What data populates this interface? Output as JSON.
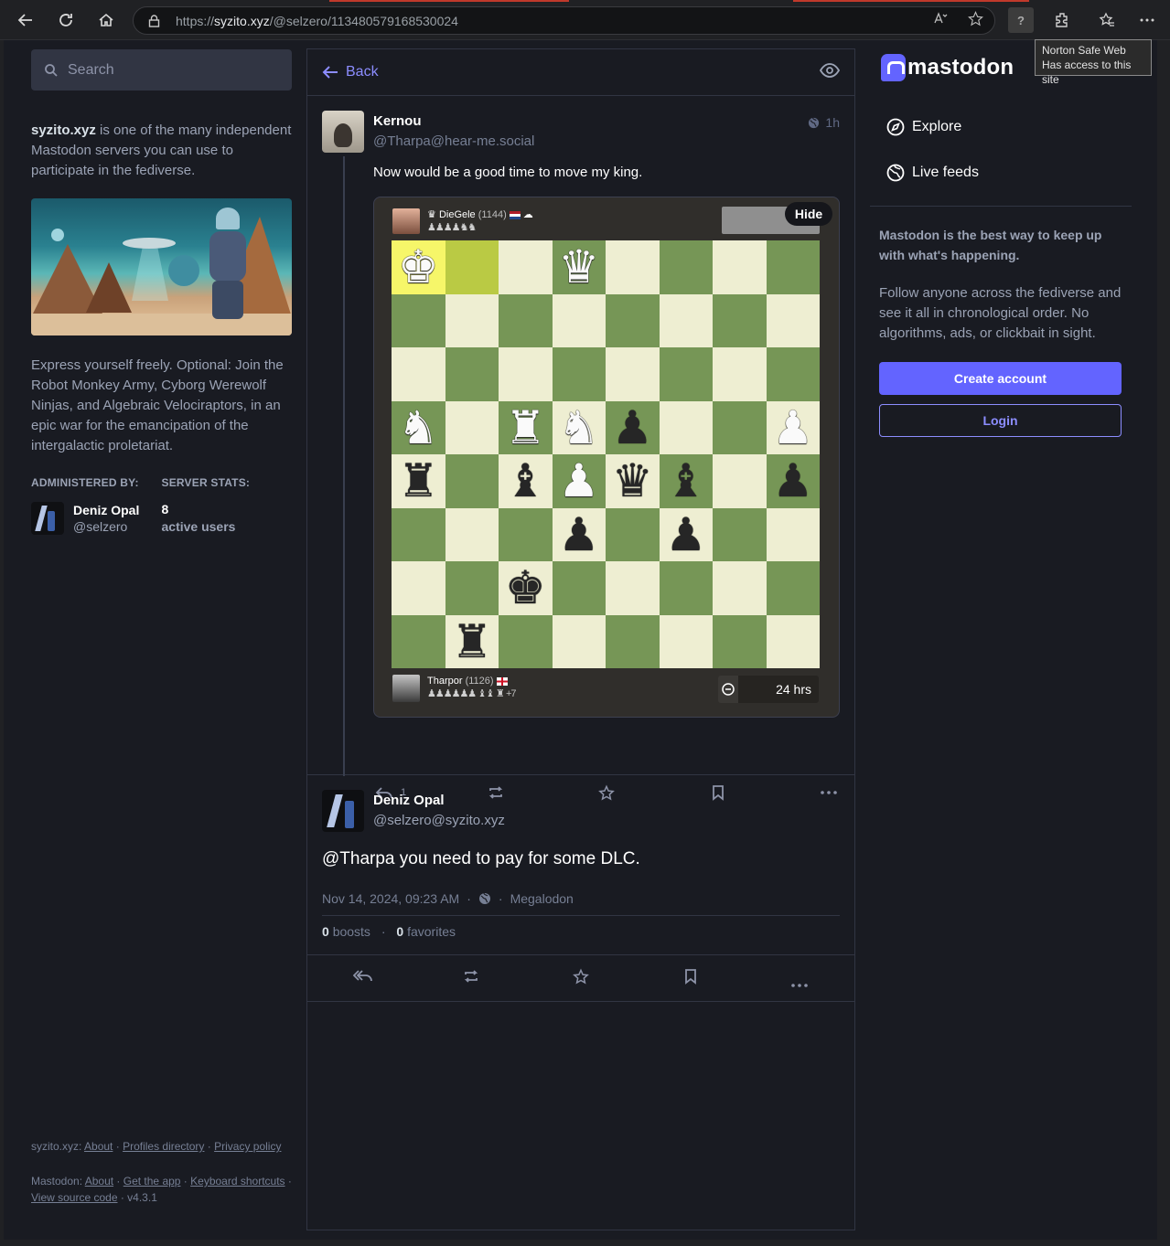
{
  "browser": {
    "url_scheme": "https://",
    "url_host": "syzito.xyz",
    "url_path": "/@selzero/113480579168530024",
    "tooltip_line1": "Norton Safe Web",
    "tooltip_line2": "Has access to this site",
    "norton_badge": "?"
  },
  "left": {
    "search_placeholder": "Search",
    "about_server": "syzito.xyz",
    "about_rest": " is one of the many independent Mastodon servers you can use to participate in the fediverse.",
    "description": "Express yourself freely. Optional: Join the Robot Monkey Army, Cyborg Werewolf Ninjas, and Algebraic Velociraptors, in an epic war for the emancipation of the intergalactic proletariat.",
    "admin_heading": "Administered by:",
    "admin_name": "Deniz Opal",
    "admin_handle": "@selzero",
    "stats_heading": "Server stats:",
    "stats_count": "8",
    "stats_label": "active users",
    "footer1_server": "syzito.xyz",
    "footer1_links": [
      "About",
      "Profiles directory",
      "Privacy policy"
    ],
    "footer2_label": "Mastodon",
    "footer2_links": [
      "About",
      "Get the app",
      "Keyboard shortcuts",
      "View source code"
    ],
    "version": "v4.3.1"
  },
  "center": {
    "back_label": "Back",
    "status1": {
      "display_name": "Kernou",
      "handle": "@Tharpa@hear-me.social",
      "time": "1h",
      "text": "Now would be a good time to move my king.",
      "reply_count": "1",
      "media": {
        "hide_label": "Hide",
        "top_player_name": "DieGele",
        "top_player_rating": "(1144)",
        "top_player_caps": "♟♟♟♟♞♞",
        "bottom_player_name": "Tharpor",
        "bottom_player_rating": "(1126)",
        "bottom_player_caps": "♟♟♟♟♟♟ ♝♝ ♜",
        "bottom_player_adv": "+7",
        "clock": "24 hrs",
        "board": [
          [
            "wK",
            "",
            "",
            "wQ",
            "",
            "",
            "",
            ""
          ],
          [
            "",
            "",
            "",
            "",
            "",
            "",
            "",
            ""
          ],
          [
            "",
            "",
            "",
            "",
            "",
            "",
            "",
            ""
          ],
          [
            "wN",
            "",
            "wR",
            "wN",
            "bP",
            "",
            "",
            "wP"
          ],
          [
            "bR",
            "",
            "bB",
            "wP",
            "bQ",
            "bB",
            "",
            "bP"
          ],
          [
            "",
            "",
            "",
            "bP",
            "",
            "bP",
            "",
            ""
          ],
          [
            "",
            "",
            "bK",
            "",
            "",
            "",
            "",
            ""
          ],
          [
            "",
            "bR",
            "",
            "",
            "",
            "",
            "",
            ""
          ]
        ]
      }
    },
    "status2": {
      "display_name": "Deniz Opal",
      "handle": "@selzero@syzito.xyz",
      "mention": "@Tharpa",
      "text_rest": " you need to pay for some DLC.",
      "datetime": "Nov 14, 2024, 09:23 AM",
      "app": "Megalodon",
      "boosts_count": "0",
      "boosts_label": "boosts",
      "favorites_count": "0",
      "favorites_label": "favorites"
    }
  },
  "right": {
    "brand": "mastodon",
    "nav": [
      "Explore",
      "Live feeds"
    ],
    "tagline": "Mastodon is the best way to keep up with what's happening.",
    "desc": "Follow anyone across the fediverse and see it all in chronological order. No algorithms, ads, or clickbait in sight.",
    "create_account": "Create account",
    "login": "Login"
  },
  "colors": {
    "accent": "#6364ff",
    "link": "#8c8dff",
    "board_light": "#eeeed2",
    "board_dark": "#769656",
    "highlight": "#f6f669"
  }
}
